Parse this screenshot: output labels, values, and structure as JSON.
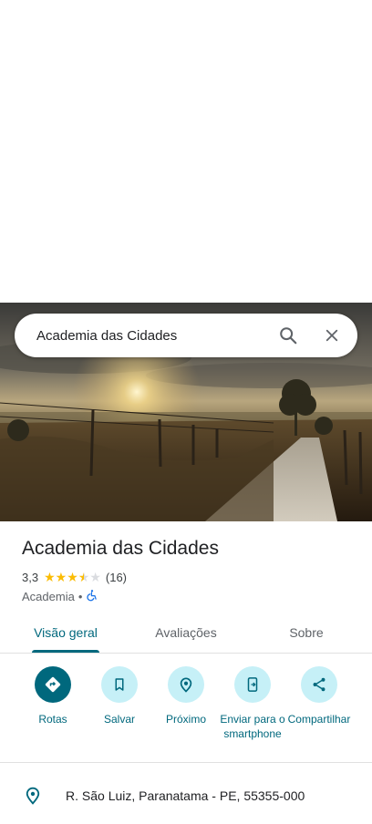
{
  "search": {
    "query": "Academia das Cidades"
  },
  "place": {
    "name": "Academia das Cidades",
    "rating": "3,3",
    "rating_value": 3.3,
    "review_count": "(16)",
    "category": "Academia",
    "separator": "•"
  },
  "tabs": [
    {
      "label": "Visão geral",
      "active": true
    },
    {
      "label": "Avaliações",
      "active": false
    },
    {
      "label": "Sobre",
      "active": false
    }
  ],
  "actions": [
    {
      "label": "Rotas",
      "icon": "directions-icon"
    },
    {
      "label": "Salvar",
      "icon": "bookmark-icon"
    },
    {
      "label": "Próximo",
      "icon": "nearby-icon"
    },
    {
      "label": "Enviar para o smartphone",
      "icon": "send-to-phone-icon"
    },
    {
      "label": "Compartilhar",
      "icon": "share-icon"
    }
  ],
  "address": {
    "text": "R. São Luiz, Paranatama - PE, 55355-000"
  },
  "colors": {
    "accent": "#00687d",
    "action_bg": "#c6f0f7",
    "star": "#fbbc04"
  }
}
